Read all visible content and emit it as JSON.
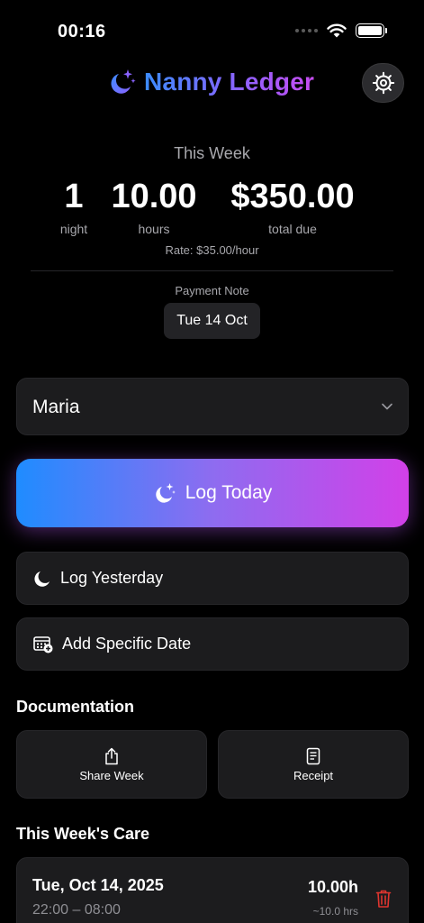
{
  "status_bar": {
    "time": "00:16"
  },
  "header": {
    "title": "Nanny Ledger"
  },
  "summary": {
    "week_label": "This Week",
    "nights_value": "1",
    "nights_label": "night",
    "hours_value": "10.00",
    "hours_label": "hours",
    "total_value": "$350.00",
    "total_label": "total due",
    "rate": "Rate: $35.00/hour",
    "payment_note_label": "Payment Note",
    "payment_note_date": "Tue 14 Oct"
  },
  "caregiver": {
    "selected": "Maria"
  },
  "actions": {
    "log_today": "Log Today",
    "log_yesterday": "Log Yesterday",
    "add_specific_date": "Add Specific Date"
  },
  "documentation": {
    "title": "Documentation",
    "share_week": "Share Week",
    "receipt": "Receipt"
  },
  "care": {
    "title": "This Week's Care",
    "entries": [
      {
        "date": "Tue, Oct 14, 2025",
        "time": "22:00 – 08:00",
        "hours": "10.00h",
        "approx": "~10.0 hrs"
      }
    ]
  },
  "colors": {
    "accent_blue": "#1f8cff",
    "accent_purple": "#d240e8",
    "delete_red": "#e0352f",
    "card_bg": "#1c1c1e"
  },
  "icons": {
    "brand": "moon-stars-icon",
    "settings": "gear-icon",
    "caregiver": "chevron-down-icon",
    "log_today": "moon-stars-icon",
    "log_yesterday": "moon-icon",
    "add_specific_date": "calendar-plus-icon",
    "share_week": "share-icon",
    "receipt": "receipt-icon",
    "delete": "trash-icon"
  }
}
